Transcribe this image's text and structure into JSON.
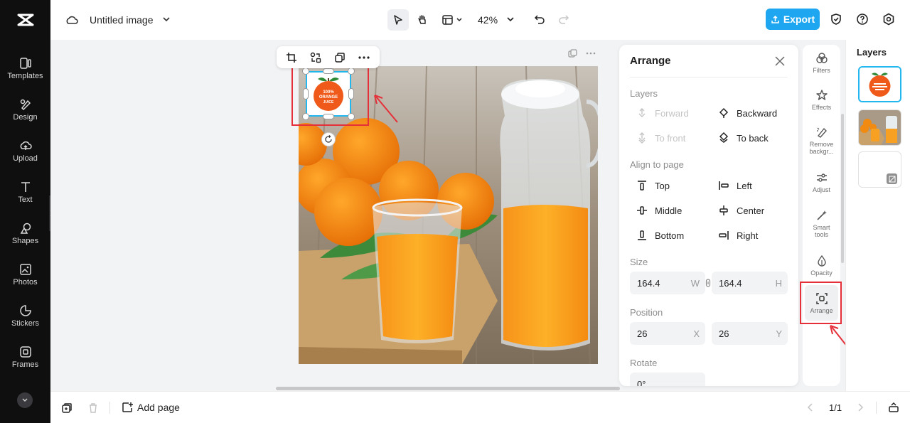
{
  "header": {
    "doc_title": "Untitled image",
    "zoom": "42%",
    "export_label": "Export"
  },
  "sidebar": {
    "items": [
      {
        "label": "Templates",
        "icon": "templates-icon"
      },
      {
        "label": "Design",
        "icon": "design-icon"
      },
      {
        "label": "Upload",
        "icon": "upload-icon"
      },
      {
        "label": "Text",
        "icon": "text-icon"
      },
      {
        "label": "Shapes",
        "icon": "shapes-icon"
      },
      {
        "label": "Photos",
        "icon": "photos-icon"
      },
      {
        "label": "Stickers",
        "icon": "stickers-icon"
      },
      {
        "label": "Frames",
        "icon": "frames-icon"
      }
    ]
  },
  "canvas": {
    "logo_text": [
      "100%",
      "ORANGE",
      "JUICE"
    ]
  },
  "arrange": {
    "title": "Arrange",
    "layers_label": "Layers",
    "forward": "Forward",
    "backward": "Backward",
    "to_front": "To front",
    "to_back": "To back",
    "align_label": "Align to page",
    "top": "Top",
    "left": "Left",
    "middle": "Middle",
    "center": "Center",
    "bottom": "Bottom",
    "right": "Right",
    "size_label": "Size",
    "width": "164.4",
    "width_suffix": "W",
    "height": "164.4",
    "height_suffix": "H",
    "position_label": "Position",
    "pos_x": "26",
    "pos_x_suffix": "X",
    "pos_y": "26",
    "pos_y_suffix": "Y",
    "rotate_label": "Rotate",
    "rotate_value": "0°"
  },
  "tools": [
    {
      "label": "Filters",
      "icon": "filters-icon"
    },
    {
      "label": "Effects",
      "icon": "effects-icon"
    },
    {
      "label": "Remove backgr...",
      "icon": "remove-background-icon"
    },
    {
      "label": "Adjust",
      "icon": "adjust-icon"
    },
    {
      "label": "Smart tools",
      "icon": "smart-tools-icon"
    },
    {
      "label": "Opacity",
      "icon": "opacity-icon"
    },
    {
      "label": "Arrange",
      "icon": "arrange-icon"
    }
  ],
  "layers_panel": {
    "title": "Layers"
  },
  "bottom": {
    "add_page": "Add page",
    "page_indicator": "1/1"
  },
  "colors": {
    "accent": "#1ea7f0",
    "annotation_red": "#e5303a",
    "selection_cyan": "#22b7ee"
  }
}
